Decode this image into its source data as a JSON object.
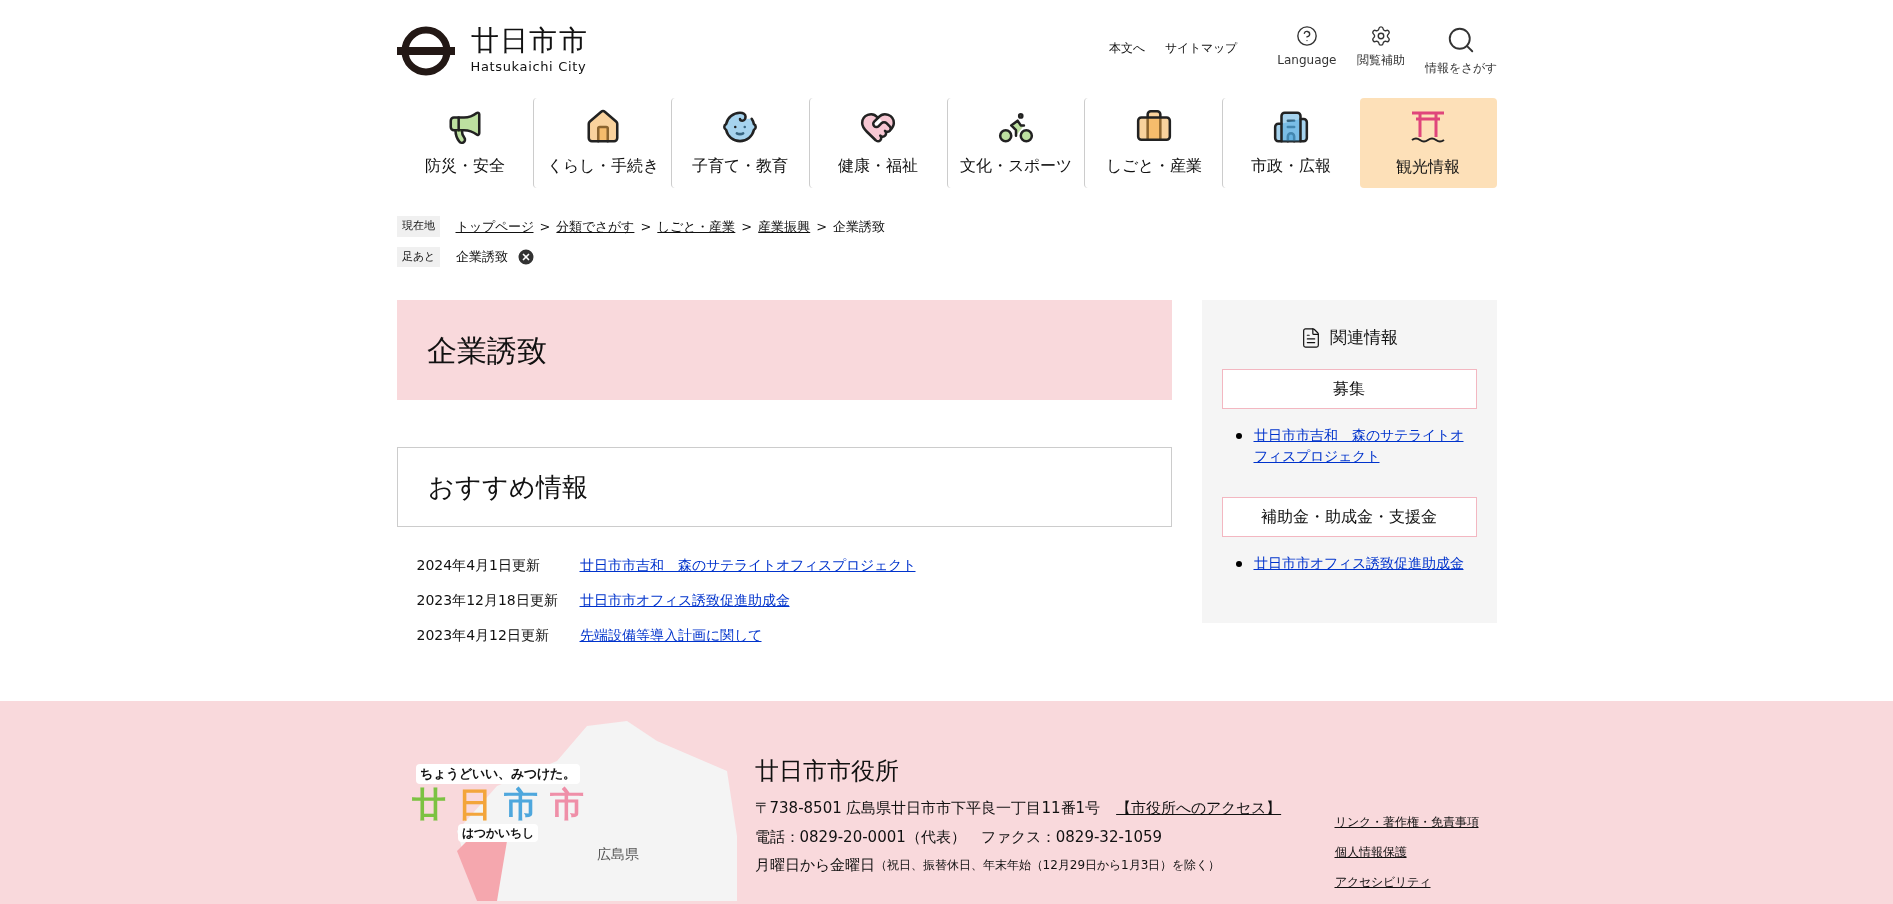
{
  "header": {
    "logo_title": "廿日市市",
    "logo_subtitle": "Hatsukaichi City",
    "links": [
      "本文へ",
      "サイトマップ"
    ],
    "tools": [
      {
        "kind": "language",
        "label": "Language"
      },
      {
        "kind": "assist",
        "label": "閲覧補助"
      },
      {
        "kind": "search",
        "label": "情報をさがす"
      }
    ]
  },
  "nav": [
    {
      "kind": "disaster",
      "label": "防災・安全",
      "selected": false
    },
    {
      "kind": "life",
      "label": "くらし・手続き",
      "selected": false
    },
    {
      "kind": "child",
      "label": "子育て・教育",
      "selected": false
    },
    {
      "kind": "health",
      "label": "健康・福祉",
      "selected": false
    },
    {
      "kind": "culture",
      "label": "文化・スポーツ",
      "selected": false
    },
    {
      "kind": "work",
      "label": "しごと・産業",
      "selected": false
    },
    {
      "kind": "city",
      "label": "市政・広報",
      "selected": false
    },
    {
      "kind": "tourism",
      "label": "観光情報",
      "selected": true
    }
  ],
  "breadcrumb": {
    "label": "現在地",
    "items": [
      {
        "text": "トップページ",
        "link": true
      },
      {
        "text": "分類でさがす",
        "link": true
      },
      {
        "text": "しごと・産業",
        "link": true
      },
      {
        "text": "産業振興",
        "link": true
      },
      {
        "text": "企業誘致",
        "link": false
      }
    ],
    "separator": ">"
  },
  "footprint": {
    "label": "足あと",
    "items": [
      "企業誘致"
    ]
  },
  "page_title": "企業誘致",
  "recommended": {
    "title": "おすすめ情報",
    "items": [
      {
        "date": "2024年4月1日更新",
        "link": "廿日市市吉和　森のサテライトオフィスプロジェクト"
      },
      {
        "date": "2023年12月18日更新",
        "link": "廿日市市オフィス誘致促進助成金"
      },
      {
        "date": "2023年4月12日更新",
        "link": "先端設備等導入計画に関して"
      }
    ]
  },
  "sidebar": {
    "title": "関連情報",
    "sections": [
      {
        "heading": "募集",
        "links": [
          "廿日市市吉和　森のサテライトオフィスプロジェクト"
        ]
      },
      {
        "heading": "補助金・助成金・支援金",
        "links": [
          "廿日市市オフィス誘致促進助成金"
        ]
      }
    ]
  },
  "footer": {
    "logo_tagline": "ちょうどいい、みつけた。",
    "logo_chars": [
      {
        "char": "廿",
        "color": "#7cc242"
      },
      {
        "char": "日",
        "color": "#f3a53b"
      },
      {
        "char": "市",
        "color": "#4ea7dd"
      },
      {
        "char": "市",
        "color": "#ef8fa8"
      }
    ],
    "logo_reading": "はつかいちし",
    "map_label": "広島県",
    "office_name": "廿日市市役所",
    "address": "〒738-8501 広島県廿日市市下平良一丁目11番1号",
    "access_link": "【市役所へのアクセス】",
    "phone": "電話：0829-20-0001（代表）　ファクス：0829-32-1059",
    "hours_days": "月曜日から金曜日",
    "hours_note": "（祝日、振替休日、年末年始（12月29日から1月3日）を除く）",
    "links": [
      "リンク・著作権・免責事項",
      "個人情報保護",
      "アクセシビリティ"
    ]
  }
}
